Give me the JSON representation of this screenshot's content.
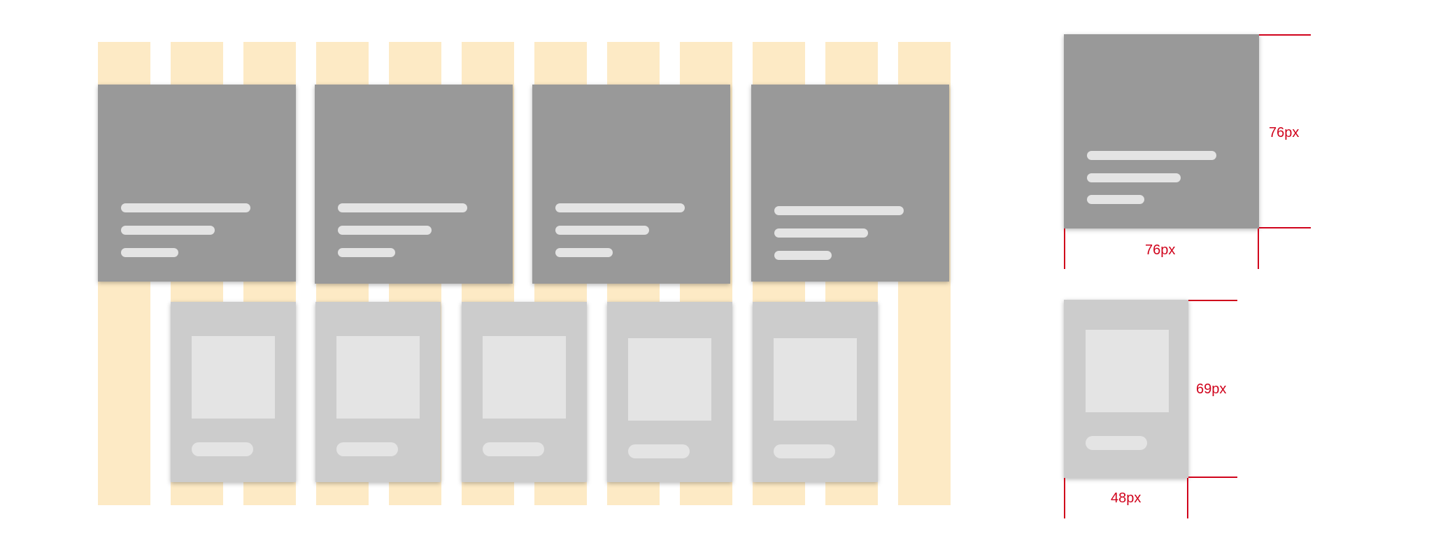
{
  "colors": {
    "grid_column": "#fdeac5",
    "card_dark": "#999999",
    "card_light": "#cccccc",
    "text_bar_on_dark": "#e4e4e4",
    "thumbnail": "#e4e4e4",
    "dimension": "#d0021b",
    "background": "#ffffff"
  },
  "grid": {
    "column_count": 12
  },
  "large_cards": {
    "count": 4,
    "text_lines_per_card": 3
  },
  "small_cards": {
    "count": 5,
    "has_thumbnail": true,
    "caption_lines_per_card": 1
  },
  "specs": {
    "large_card": {
      "height_label": "76px",
      "width_label": "76px"
    },
    "small_card": {
      "height_label": "69px",
      "width_label": "48px"
    }
  }
}
